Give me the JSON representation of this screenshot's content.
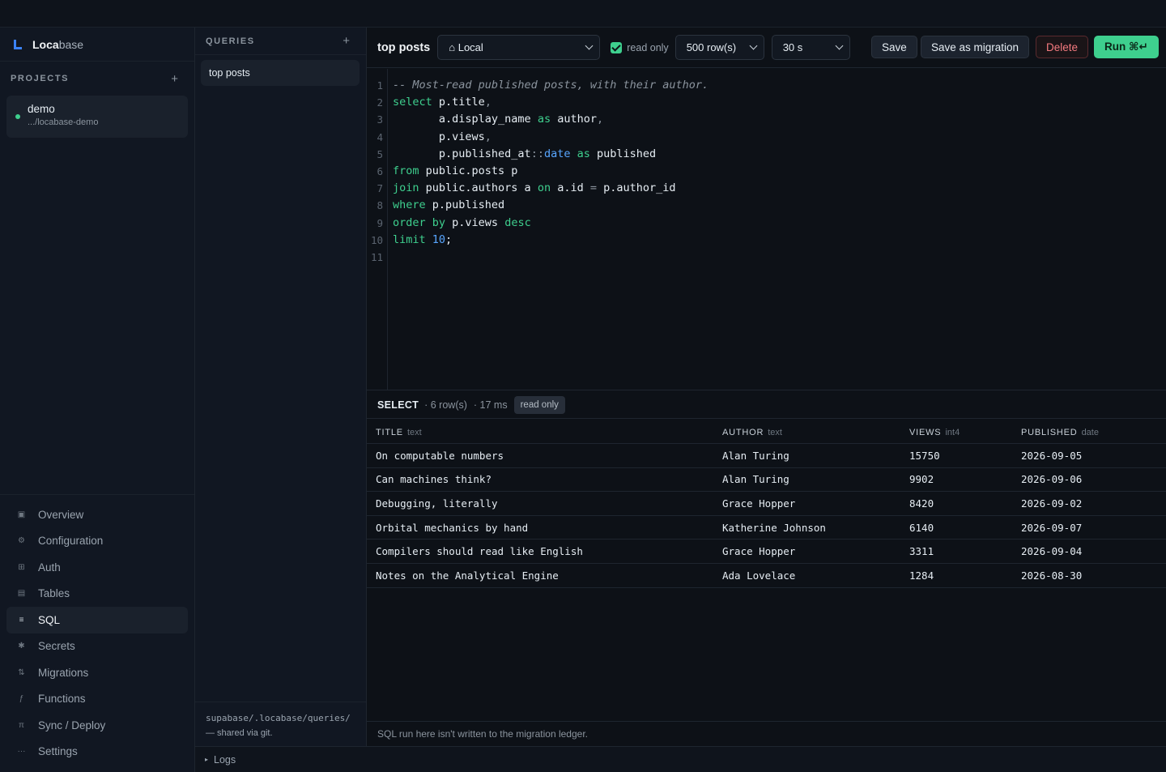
{
  "brand": {
    "name_a": "Loca",
    "name_b": "base"
  },
  "projects": {
    "title": "PROJECTS",
    "items": [
      {
        "name": "demo",
        "path": ".../locabase-demo"
      }
    ]
  },
  "nav": {
    "items": [
      {
        "label": "Overview",
        "icon": "▣"
      },
      {
        "label": "Configuration",
        "icon": "⚙"
      },
      {
        "label": "Auth",
        "icon": "⊞"
      },
      {
        "label": "Tables",
        "icon": "▤"
      },
      {
        "label": "SQL",
        "icon": "≡"
      },
      {
        "label": "Secrets",
        "icon": "✱"
      },
      {
        "label": "Migrations",
        "icon": "⇅"
      },
      {
        "label": "Functions",
        "icon": "ƒ"
      },
      {
        "label": "Sync / Deploy",
        "icon": "π"
      },
      {
        "label": "Settings",
        "icon": "···"
      }
    ]
  },
  "queries": {
    "title": "QUERIES",
    "items": [
      {
        "label": "top posts"
      }
    ],
    "footer_path": "supabase/.locabase/queries/",
    "footer_note": "— shared via git."
  },
  "logs": {
    "label": "Logs",
    "caret": "▸"
  },
  "toolbar": {
    "query_title": "top posts",
    "target": "⌂ Local",
    "read_only_label": "read only",
    "read_only_checked": true,
    "row_limit": "500 row(s)",
    "timeout": "30 s",
    "save_label": "Save",
    "save_migration_label": "Save as migration",
    "delete_label": "Delete",
    "run_label": "Run ⌘↵"
  },
  "editor": {
    "line_numbers": [
      "1",
      "2",
      "3",
      "4",
      "5",
      "6",
      "7",
      "8",
      "9",
      "10",
      "11"
    ]
  },
  "results": {
    "kind": "SELECT",
    "rows_meta": "· 6 row(s)",
    "time_meta": "· 17 ms",
    "badge": "read only",
    "columns": [
      {
        "name": "TITLE",
        "type": "text"
      },
      {
        "name": "AUTHOR",
        "type": "text"
      },
      {
        "name": "VIEWS",
        "type": "int4"
      },
      {
        "name": "PUBLISHED",
        "type": "date"
      }
    ],
    "rows": [
      [
        "On computable numbers",
        "Alan Turing",
        "15750",
        "2026-09-05"
      ],
      [
        "Can machines think?",
        "Alan Turing",
        "9902",
        "2026-09-06"
      ],
      [
        "Debugging, literally",
        "Grace Hopper",
        "8420",
        "2026-09-02"
      ],
      [
        "Orbital mechanics by hand",
        "Katherine Johnson",
        "6140",
        "2026-09-07"
      ],
      [
        "Compilers should read like English",
        "Grace Hopper",
        "3311",
        "2026-09-04"
      ],
      [
        "Notes on the Analytical Engine",
        "Ada Lovelace",
        "1284",
        "2026-08-30"
      ]
    ],
    "footer": "SQL run here isn't written to the migration ledger."
  },
  "colors": {
    "accent": "#3ecf8e",
    "danger": "#f47a7f",
    "keyword": "#3ecf8e",
    "type": "#58a6ff"
  }
}
